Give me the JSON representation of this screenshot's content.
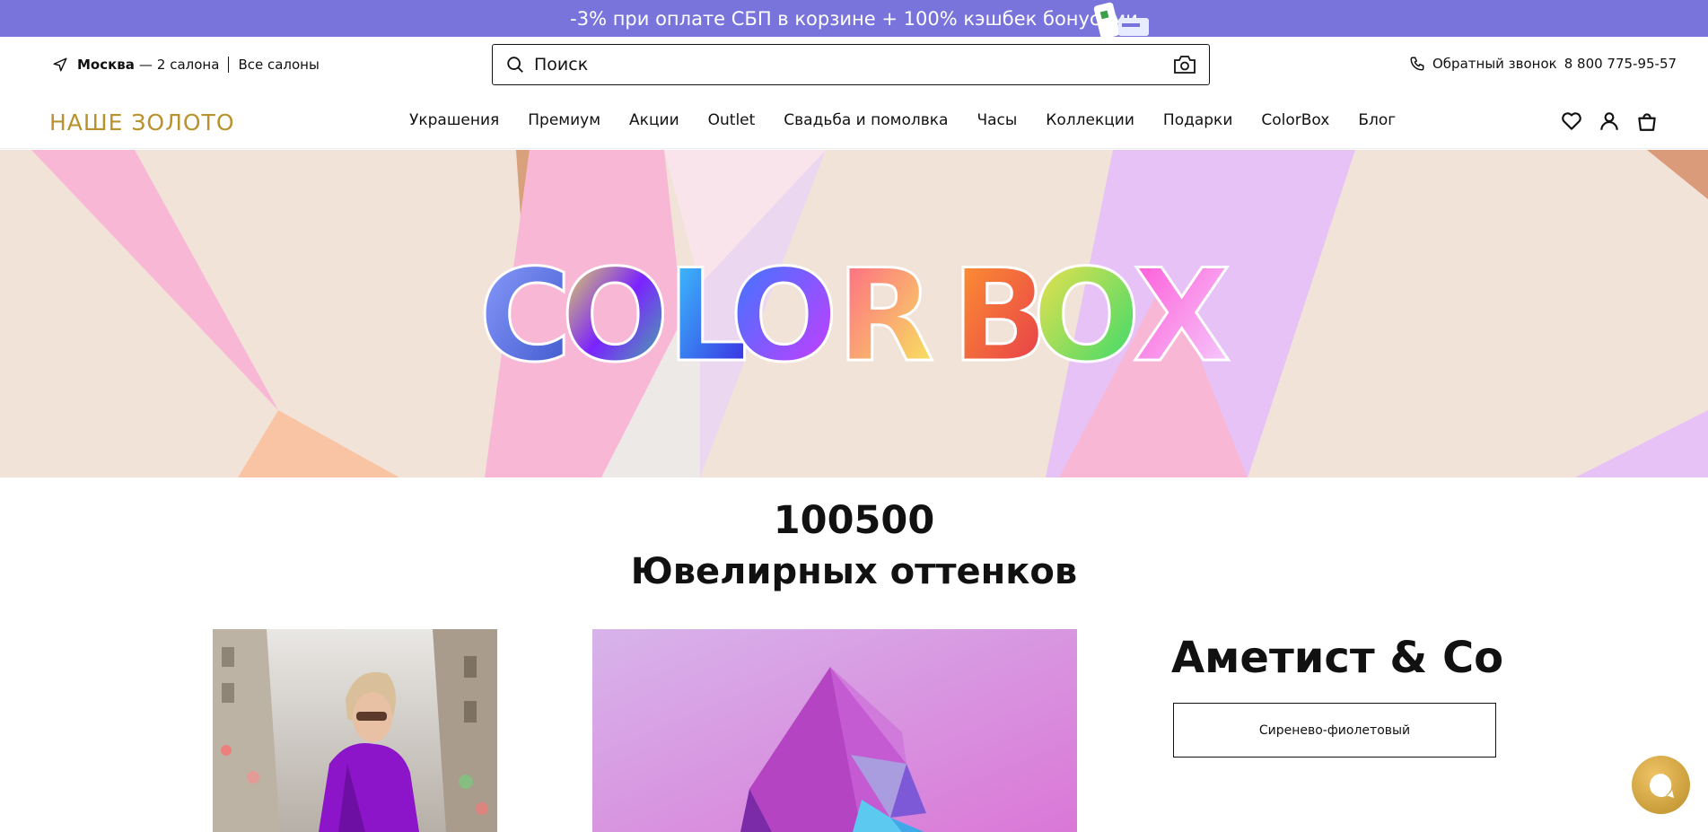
{
  "promo": {
    "text": "-3% при оплате СБП в корзине + 100% кэшбек бонусами"
  },
  "location": {
    "city": "Москва",
    "dash": "—",
    "salons": "2 салона",
    "all_salons": "Все салоны"
  },
  "search": {
    "placeholder": "Поиск"
  },
  "callback": {
    "label": "Обратный звонок",
    "phone": "8 800 775-95-57"
  },
  "brand": {
    "logo": "НАШЕ ЗОЛОТО",
    "color": "#b9922e"
  },
  "nav": {
    "items": [
      "Украшения",
      "Премиум",
      "Акции",
      "Outlet",
      "Свадьба и помолвка",
      "Часы",
      "Коллекции",
      "Подарки",
      "ColorBox",
      "Блог"
    ]
  },
  "hero": {
    "letters": [
      "C",
      "O",
      "L",
      "O",
      "R",
      "B",
      "O",
      "X"
    ]
  },
  "headline": {
    "number": "100500",
    "subtitle": "Ювелирных оттенков"
  },
  "collection": {
    "title": "Аметист & Co",
    "color_button": "Сиренево-фиолетовый"
  },
  "colors": {
    "promo_bg": "#7874db",
    "accent": "#b9922e"
  }
}
